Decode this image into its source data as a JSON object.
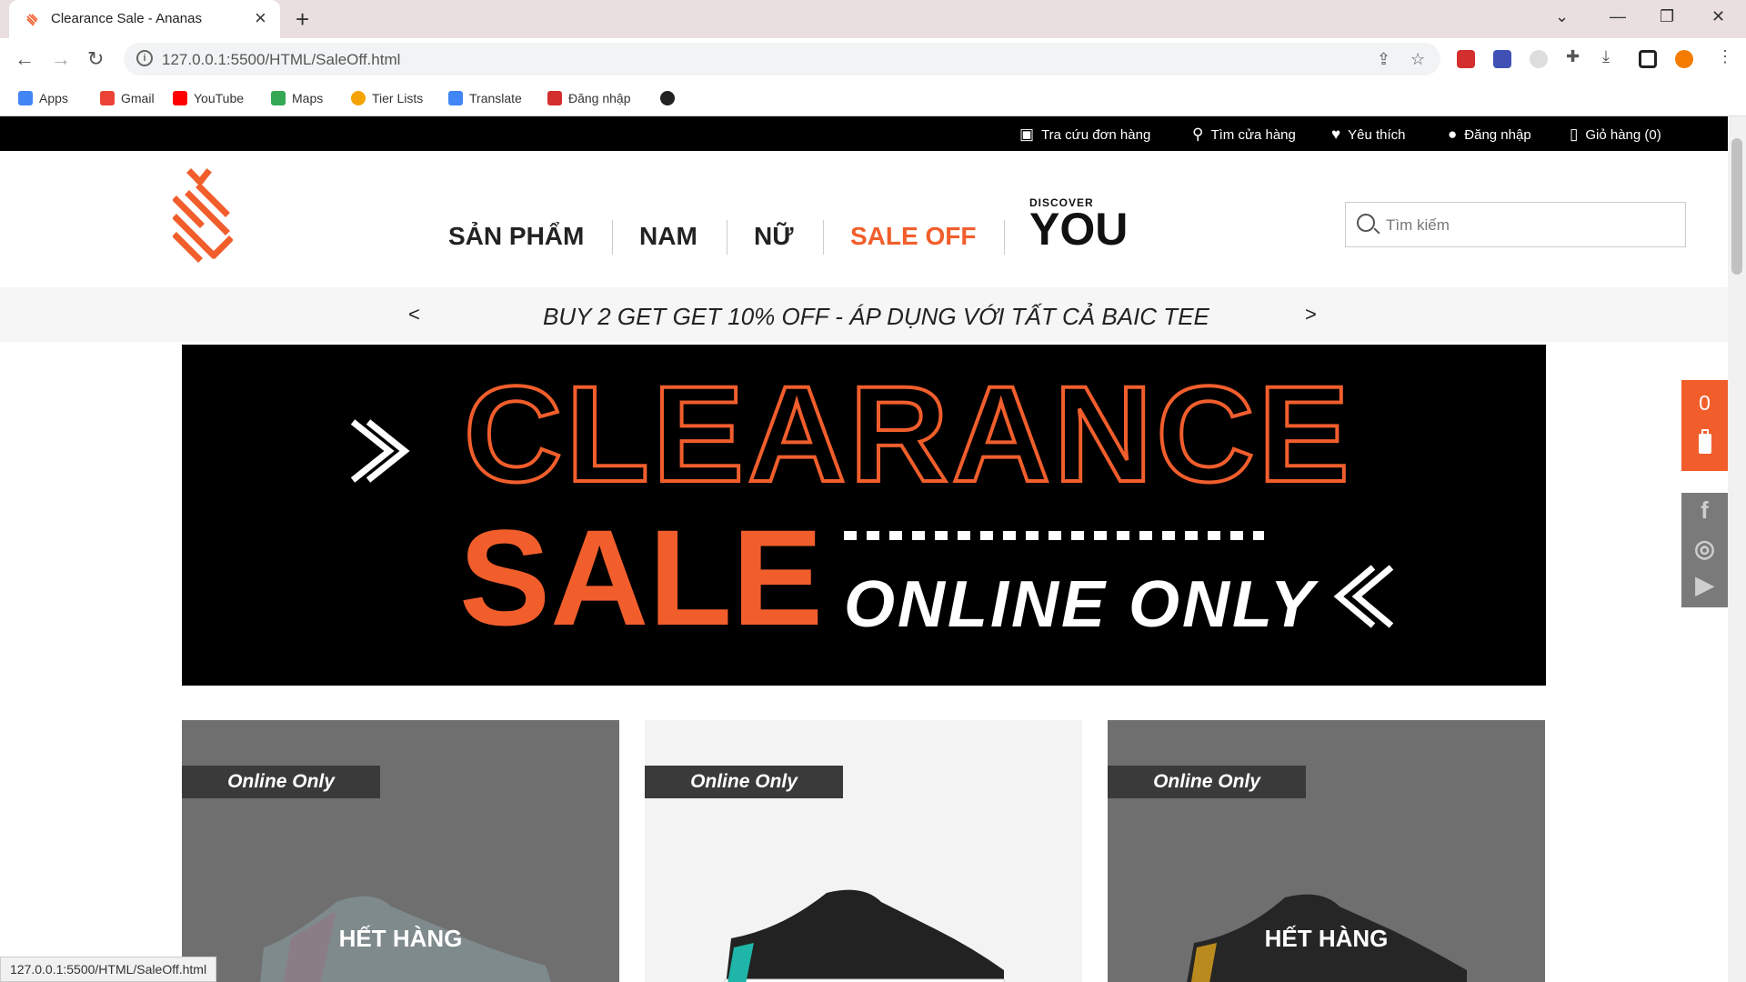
{
  "browser": {
    "tab_title": "Clearance Sale - Ananas",
    "url": "127.0.0.1:5500/HTML/SaleOff.html",
    "status_url": "127.0.0.1:5500/HTML/SaleOff.html",
    "bookmarks": [
      {
        "label": "Apps",
        "icon": "apps-grid-icon",
        "color": "#4285f4"
      },
      {
        "label": "Gmail",
        "icon": "gmail-icon",
        "color": "#ea4335"
      },
      {
        "label": "YouTube",
        "icon": "youtube-icon",
        "color": "#ff0000"
      },
      {
        "label": "Maps",
        "icon": "maps-pin-icon",
        "color": "#34a853"
      },
      {
        "label": "Tier Lists",
        "icon": "tierlists-icon",
        "color": "#f4a300"
      },
      {
        "label": "Translate",
        "icon": "translate-icon",
        "color": "#4285f4"
      },
      {
        "label": "Đăng nhập",
        "icon": "login-site-icon",
        "color": "#d32f2f"
      },
      {
        "label": "",
        "icon": "globe-icon",
        "color": "#222222"
      }
    ]
  },
  "topbar": {
    "items": [
      {
        "label": "Tra cứu đơn hàng",
        "icon": "box-icon"
      },
      {
        "label": "Tìm cửa hàng",
        "icon": "location-pin-icon"
      },
      {
        "label": "Yêu thích",
        "icon": "heart-icon"
      },
      {
        "label": "Đăng nhập",
        "icon": "user-icon"
      },
      {
        "label": "Giỏ hàng (0)",
        "icon": "shopping-bag-icon"
      }
    ]
  },
  "nav": {
    "items": [
      {
        "label": "SẢN PHẨM",
        "active": false
      },
      {
        "label": "NAM",
        "active": false
      },
      {
        "label": "NỮ",
        "active": false
      },
      {
        "label": "SALE OFF",
        "active": true
      }
    ],
    "discover_small": "DISCOVER",
    "discover_big": "YOU",
    "search_placeholder": "Tìm kiếm"
  },
  "promo": {
    "text": "BUY 2 GET GET 10% OFF - ÁP DỤNG VỚI TẤT CẢ BAIC TEE",
    "prev": "<",
    "next": ">"
  },
  "banner": {
    "line1": "CLEARANCE",
    "line2": "SALE",
    "line3": "ONLINE ONLY"
  },
  "cards": [
    {
      "tag": "Online Only",
      "soldout": "HẾT HÀNG"
    },
    {
      "tag": "Online Only",
      "soldout": ""
    },
    {
      "tag": "Online Only",
      "soldout": "HẾT HÀNG"
    }
  ],
  "side_cart": {
    "count": "0"
  },
  "colors": {
    "accent": "#f15e2c",
    "topbar": "#000000"
  }
}
